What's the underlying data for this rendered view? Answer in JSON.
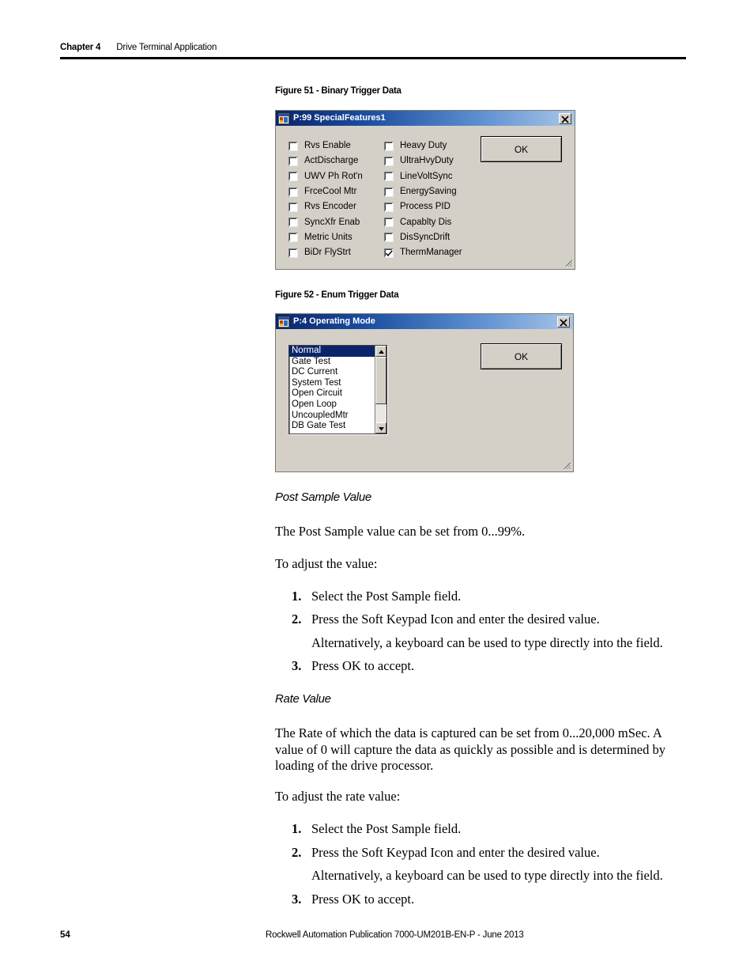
{
  "header": {
    "chapter_label": "Chapter 4",
    "chapter_title": "Drive Terminal Application"
  },
  "figure51": {
    "caption": "Figure 51 - Binary Trigger Data",
    "dialog": {
      "title": "P:99 SpecialFeatures1",
      "icon": "window-form-icon",
      "close_label": "✕",
      "ok_label": "OK",
      "column1": [
        {
          "label": "Rvs Enable",
          "checked": false
        },
        {
          "label": "ActDischarge",
          "checked": false
        },
        {
          "label": "UWV Ph Rot'n",
          "checked": false
        },
        {
          "label": "FrceCool Mtr",
          "checked": false
        },
        {
          "label": "Rvs Encoder",
          "checked": false
        },
        {
          "label": "SyncXfr Enab",
          "checked": false
        },
        {
          "label": "Metric Units",
          "checked": false
        },
        {
          "label": "BiDr FlyStrt",
          "checked": false
        }
      ],
      "column2": [
        {
          "label": "Heavy Duty",
          "checked": false
        },
        {
          "label": "UltraHvyDuty",
          "checked": false
        },
        {
          "label": "LineVoltSync",
          "checked": false
        },
        {
          "label": "EnergySaving",
          "checked": false
        },
        {
          "label": "Process PID",
          "checked": false
        },
        {
          "label": "Capablty Dis",
          "checked": false
        },
        {
          "label": "DisSyncDrift",
          "checked": false
        },
        {
          "label": "ThermManager",
          "checked": true
        }
      ]
    }
  },
  "figure52": {
    "caption": "Figure 52 - Enum Trigger Data",
    "dialog": {
      "title": "P:4 Operating Mode",
      "icon": "window-form-icon",
      "close_label": "✕",
      "ok_label": "OK",
      "listbox": {
        "selected": "Normal",
        "items": [
          "Normal",
          "Gate Test",
          "DC Current",
          "System Test",
          "Open Circuit",
          "Open Loop",
          "UncoupledMtr",
          "DB Gate Test"
        ]
      }
    }
  },
  "sections": [
    {
      "heading": "Post Sample Value",
      "intro": "The Post Sample value can be set from 0...99%.",
      "lead_in": "To adjust the value:",
      "steps": [
        {
          "num": "1.",
          "text": "Select the Post Sample field."
        },
        {
          "num": "2.",
          "text": "Press the Soft Keypad Icon and enter the desired value."
        },
        {
          "num": "",
          "text": "Alternatively, a keyboard can be used to type directly into the field."
        },
        {
          "num": "3.",
          "text": "Press OK to accept."
        }
      ]
    },
    {
      "heading": "Rate Value",
      "intro": "The Rate of which the data is captured can be set from 0...20,000 mSec. A value of 0 will capture the data as quickly as possible and is determined by loading of the drive processor.",
      "lead_in": "To adjust the rate value:",
      "steps": [
        {
          "num": "1.",
          "text": "Select the Post Sample field."
        },
        {
          "num": "2.",
          "text": "Press the Soft Keypad Icon and enter the desired value."
        },
        {
          "num": "",
          "text": "Alternatively, a keyboard can be used to type directly into the field."
        },
        {
          "num": "3.",
          "text": "Press OK to accept."
        }
      ]
    }
  ],
  "footer": {
    "page_number": "54",
    "publication": "Rockwell Automation Publication 7000-UM201B-EN-P - June 2013"
  }
}
